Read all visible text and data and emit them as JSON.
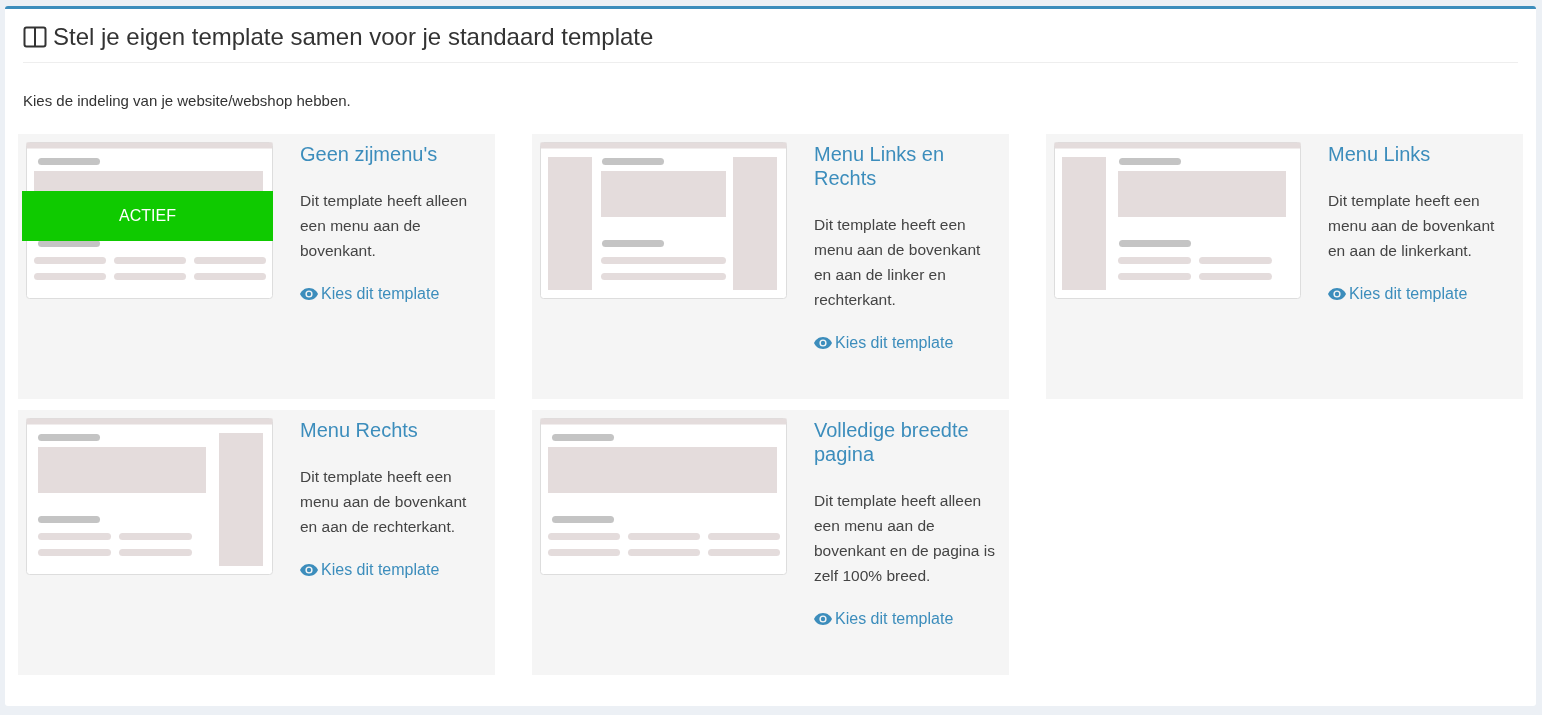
{
  "panel": {
    "title": "Stel je eigen template samen voor je standaard template",
    "intro": "Kies de indeling van je website/webshop hebben.",
    "active_label": "ACTIEF"
  },
  "templates": [
    {
      "kind": "none",
      "name": "Geen zijmenu's",
      "description": "Dit template heeft alleen een menu aan de bovenkant.",
      "link": "Kies dit template",
      "active": true
    },
    {
      "kind": "both",
      "name": "Menu Links en Rechts",
      "description": "Dit template heeft een menu aan de bovenkant en aan de linker en rechterkant.",
      "link": "Kies dit template",
      "active": false
    },
    {
      "kind": "left",
      "name": "Menu Links",
      "description": "Dit template heeft een menu aan de bovenkant en aan de linkerkant.",
      "link": "Kies dit template",
      "active": false
    },
    {
      "kind": "right",
      "name": "Menu Rechts",
      "description": "Dit template heeft een menu aan de bovenkant en aan de rechterkant.",
      "link": "Kies dit template",
      "active": false
    },
    {
      "kind": "full",
      "name": "Volledige breedte pagina",
      "description": "Dit template heeft alleen een menu aan de bovenkant en de pagina is zelf 100% breed.",
      "link": "Kies dit template",
      "active": false
    }
  ]
}
